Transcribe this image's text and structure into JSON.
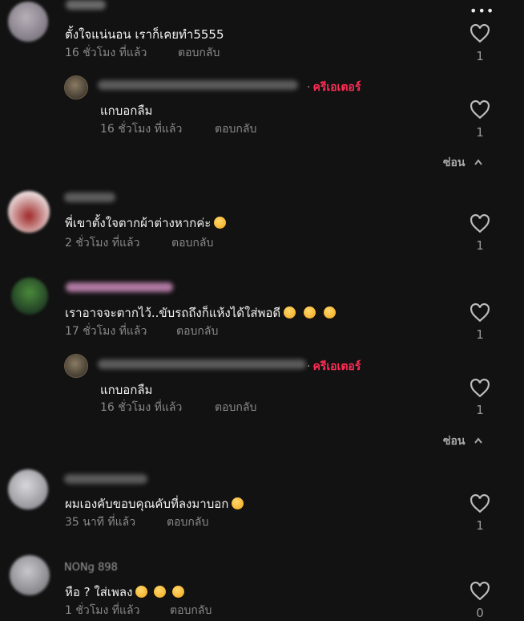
{
  "more_menu": "•••",
  "comments": [
    {
      "text": "ตั้งใจแน่นอน เราก็เคยทำ5555",
      "time": "16 ชั่วโมง ที่แล้ว",
      "reply": "ตอบกลับ",
      "likes": "1"
    },
    {
      "text": "แกบอกลืม",
      "time": "16 ชั่วโมง ที่แล้ว",
      "reply": "ตอบกลับ",
      "likes": "1",
      "creator": "ครีเอเตอร์"
    },
    {
      "text": "พี่เขาตั้งใจตากผ้าต่างหากค่ะ",
      "time": "2 ชั่วโมง ที่แล้ว",
      "reply": "ตอบกลับ",
      "likes": "1"
    },
    {
      "text": "เราอาจจะตากไว้..ขับรถถึงก็แห้งได้ใส่พอดี",
      "time": "17 ชั่วโมง ที่แล้ว",
      "reply": "ตอบกลับ",
      "likes": "1"
    },
    {
      "text": "แกบอกลืม",
      "time": "16 ชั่วโมง ที่แล้ว",
      "reply": "ตอบกลับ",
      "likes": "1",
      "creator": "ครีเอเตอร์"
    },
    {
      "text": "ผมเองคับขอบคุณคับที่ลงมาบอก",
      "time": "35 นาที ที่แล้ว",
      "reply": "ตอบกลับ",
      "likes": "1"
    },
    {
      "text": "หือ ? ใส่เพลง",
      "time": "1 ชั่วโมง ที่แล้ว",
      "reply": "ตอบกลับ",
      "likes": "0"
    }
  ],
  "hide_label": "ซ่อน",
  "partial_username": "NONg 898",
  "accent": "#ff2d55"
}
